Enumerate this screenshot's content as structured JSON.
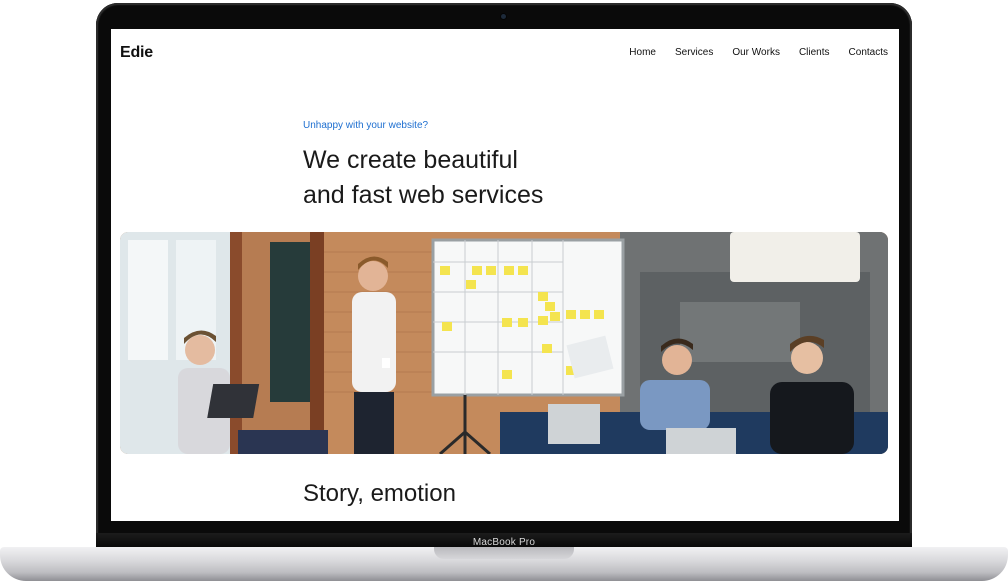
{
  "device": {
    "model_label": "MacBook Pro"
  },
  "site": {
    "logo": "Edie",
    "nav": [
      "Home",
      "Services",
      "Our Works",
      "Clients",
      "Contacts"
    ],
    "hero": {
      "eyebrow": "Unhappy with your website?",
      "headline_line1": "We create beautiful",
      "headline_line2": "and fast web services"
    },
    "section_title": "Story, emotion"
  },
  "colors": {
    "accent": "#1e6fd0",
    "text": "#1a1a1a"
  }
}
